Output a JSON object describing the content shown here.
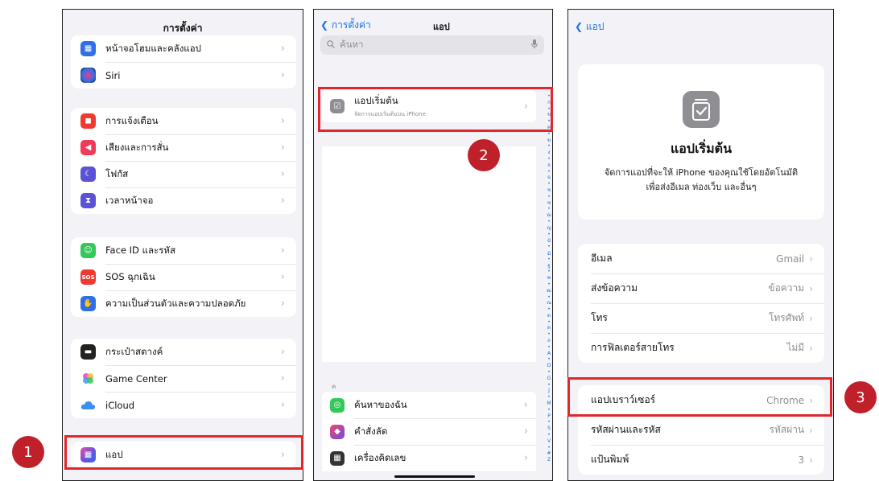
{
  "panel1": {
    "title": "การตั้งค่า",
    "groups": [
      [
        {
          "label": "หน้าจอโฮมและคลังแอป",
          "icon": "home-screen-icon",
          "color": "#2f6fe6",
          "glyph": "▦"
        },
        {
          "label": "Siri",
          "icon": "siri-icon",
          "color": "#1c1c3a",
          "glyph": "◉"
        }
      ],
      [
        {
          "label": "การแจ้งเตือน",
          "icon": "notifications-icon",
          "color": "#ef3a32",
          "glyph": "◼"
        },
        {
          "label": "เสียงและการสั่น",
          "icon": "sounds-icon",
          "color": "#ef3a5a",
          "glyph": "◀"
        },
        {
          "label": "โฟกัส",
          "icon": "focus-moon-icon",
          "color": "#5b52d6",
          "glyph": "☾"
        },
        {
          "label": "เวลาหน้าจอ",
          "icon": "screen-time-icon",
          "color": "#5b52d6",
          "glyph": "⧗"
        }
      ],
      [
        {
          "label": "Face ID และรหัส",
          "icon": "face-id-icon",
          "color": "#34c759",
          "glyph": "☺"
        },
        {
          "label": "SOS ฉุกเฉิน",
          "icon": "sos-icon",
          "color": "#ef3a32",
          "glyph": "SOS"
        },
        {
          "label": "ความเป็นส่วนตัวและความปลอดภัย",
          "icon": "privacy-hand-icon",
          "color": "#2f6fe6",
          "glyph": "✋"
        }
      ],
      [
        {
          "label": "กระเป๋าสตางค์",
          "icon": "wallet-icon",
          "color": "#222222",
          "glyph": "▬"
        },
        {
          "label": "Game Center",
          "icon": "game-center-icon",
          "color": "#e85ad0",
          "glyph": "●"
        },
        {
          "label": "iCloud",
          "icon": "icloud-icon",
          "color": "#4a9af5",
          "glyph": "☁"
        }
      ],
      [
        {
          "label": "แอป",
          "icon": "apps-grid-icon",
          "color": "#6a4fe0",
          "glyph": "▦"
        }
      ]
    ]
  },
  "panel2": {
    "back": "การตั้งค่า",
    "title": "แอป",
    "search_placeholder": "ค้นหา",
    "default_apps": {
      "title": "แอปเริ่มต้น",
      "subtitle": "จัดการแอปเริ่มต้นบน iPhone"
    },
    "section_letter": "ค",
    "apps": [
      {
        "label": "ค้นหาของฉัน",
        "icon": "find-my-icon",
        "color": "#34c759",
        "glyph": "◎"
      },
      {
        "label": "คำสั่งลัด",
        "icon": "shortcuts-icon",
        "color": "#e8406a",
        "glyph": "◆"
      },
      {
        "label": "เครื่องคิดเลข",
        "icon": "calculator-icon",
        "color": "#333333",
        "glyph": "▦"
      }
    ],
    "index": [
      "•",
      "ก",
      "•",
      "ข",
      "•",
      "ค",
      "•",
      "ฆ",
      "•",
      "ง",
      "•",
      "จ",
      "•",
      "ฉ",
      "•",
      "ช",
      "•",
      "ซ",
      "•",
      "ฌ",
      "•",
      "ญ",
      "•",
      "ฎ",
      "•",
      "ฏ",
      "•",
      "ฐ",
      "•",
      "ฑ",
      "•",
      "ฒ",
      "•",
      "ณ",
      "•",
      "ด",
      "•",
      "ต",
      "•",
      "ถ",
      "•",
      "A",
      "•",
      "D",
      "•",
      "G",
      "•",
      "J",
      "•",
      "M",
      "•",
      "P",
      "•",
      "S",
      "•",
      "V",
      "•",
      "#",
      "Z"
    ]
  },
  "panel3": {
    "back": "แอป",
    "hero_title": "แอปเริ่มต้น",
    "hero_desc_1": "จัดการแอปที่จะให้ iPhone ของคุณใช้โดยอัตโนมัติ",
    "hero_desc_2": "เพื่อส่งอีเมล ท่องเว็บ และอื่นๆ",
    "group1": [
      {
        "label": "อีเมล",
        "value": "Gmail"
      },
      {
        "label": "ส่งข้อความ",
        "value": "ข้อความ"
      },
      {
        "label": "โทร",
        "value": "โทรศัพท์"
      },
      {
        "label": "การฟิลเตอร์สายโทร",
        "value": "ไม่มี"
      }
    ],
    "group2": [
      {
        "label": "แอปเบราว์เซอร์",
        "value": "Chrome"
      },
      {
        "label": "รหัสผ่านและรหัส",
        "value": "รหัสผ่าน"
      },
      {
        "label": "แป้นพิมพ์",
        "value": "3"
      }
    ]
  },
  "annotations": {
    "step1": "1",
    "step2": "2",
    "step3": "3",
    "highlight_color": "#e2262b"
  }
}
